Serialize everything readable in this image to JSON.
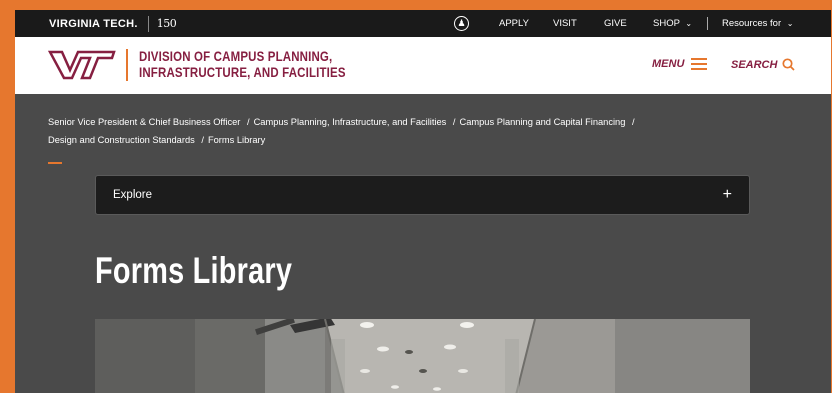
{
  "topbar": {
    "brand": "VIRGINIA TECH.",
    "anniversary": "150",
    "accessibility_icon": "accessibility-icon",
    "links": [
      "APPLY",
      "VISIT",
      "GIVE"
    ],
    "shop": "SHOP",
    "resources": "Resources for"
  },
  "header": {
    "logo_text": "VT",
    "division_line1": "DIVISION OF CAMPUS PLANNING,",
    "division_line2": "INFRASTRUCTURE, AND FACILITIES",
    "menu": "MENU",
    "search": "SEARCH"
  },
  "breadcrumb": [
    "Senior Vice President & Chief Business Officer",
    "Campus Planning, Infrastructure, and Facilities",
    "Campus Planning and Capital Financing",
    "Design and Construction Standards",
    "Forms Library"
  ],
  "explore": {
    "label": "Explore",
    "toggle": "+"
  },
  "page": {
    "title": "Forms Library"
  },
  "colors": {
    "maroon": "#861f41",
    "orange": "#e6772e",
    "dark": "#1a1a1a",
    "content_bg": "#4a4a4a"
  }
}
